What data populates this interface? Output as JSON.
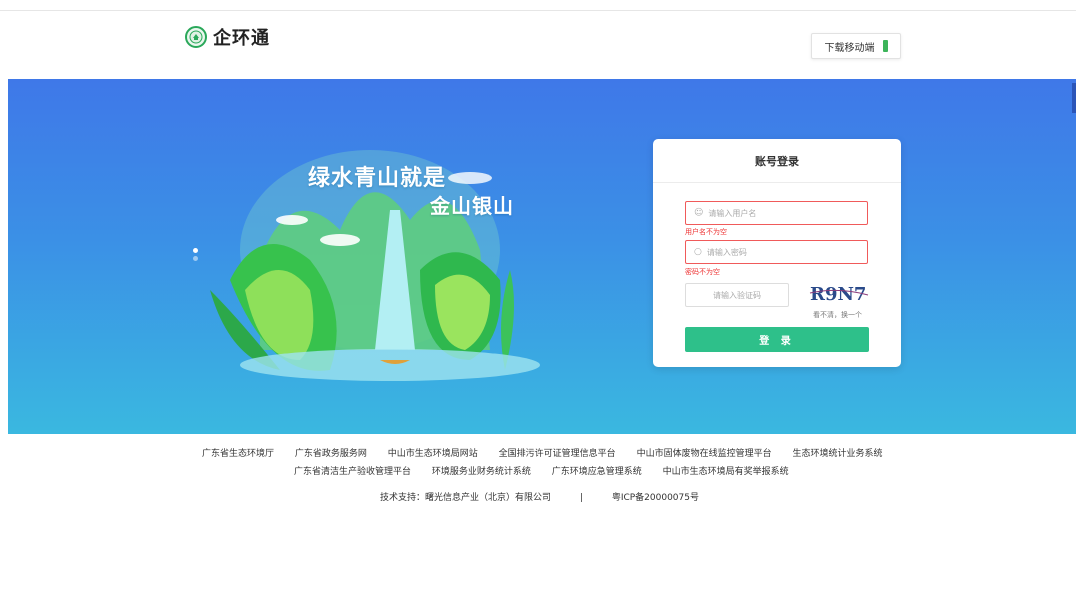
{
  "header": {
    "app_name": "企环通",
    "download_label": "下载移动端"
  },
  "banner": {
    "slogan_line1": "绿水青山就是",
    "slogan_line2": "金山银山"
  },
  "login": {
    "title": "账号登录",
    "username_placeholder": "请输入用户名",
    "username_error": "用户名不为空",
    "password_placeholder": "请输入密码",
    "password_error": "密码不为空",
    "captcha_placeholder": "请输入验证码",
    "captcha_text": "R9N7",
    "captcha_refresh": "看不清，换一个",
    "submit_label": "登 录"
  },
  "footer": {
    "links_row1": [
      "广东省生态环境厅",
      "广东省政务服务网",
      "中山市生态环境局网站",
      "全国排污许可证管理信息平台",
      "中山市固体废物在线监控管理平台",
      "生态环境统计业务系统"
    ],
    "links_row2": [
      "广东省清洁生产验收管理平台",
      "环境服务业财务统计系统",
      "广东环境应急管理系统",
      "中山市生态环境局有奖举报系统"
    ],
    "tech_support": "技术支持：曙光信息产业（北京）有限公司",
    "separator": "|",
    "icp": "粤ICP备20000075号"
  },
  "colors": {
    "brand_green": "#2ec08a",
    "error_red": "#ee3333",
    "banner_blue": "#3f78e8"
  }
}
